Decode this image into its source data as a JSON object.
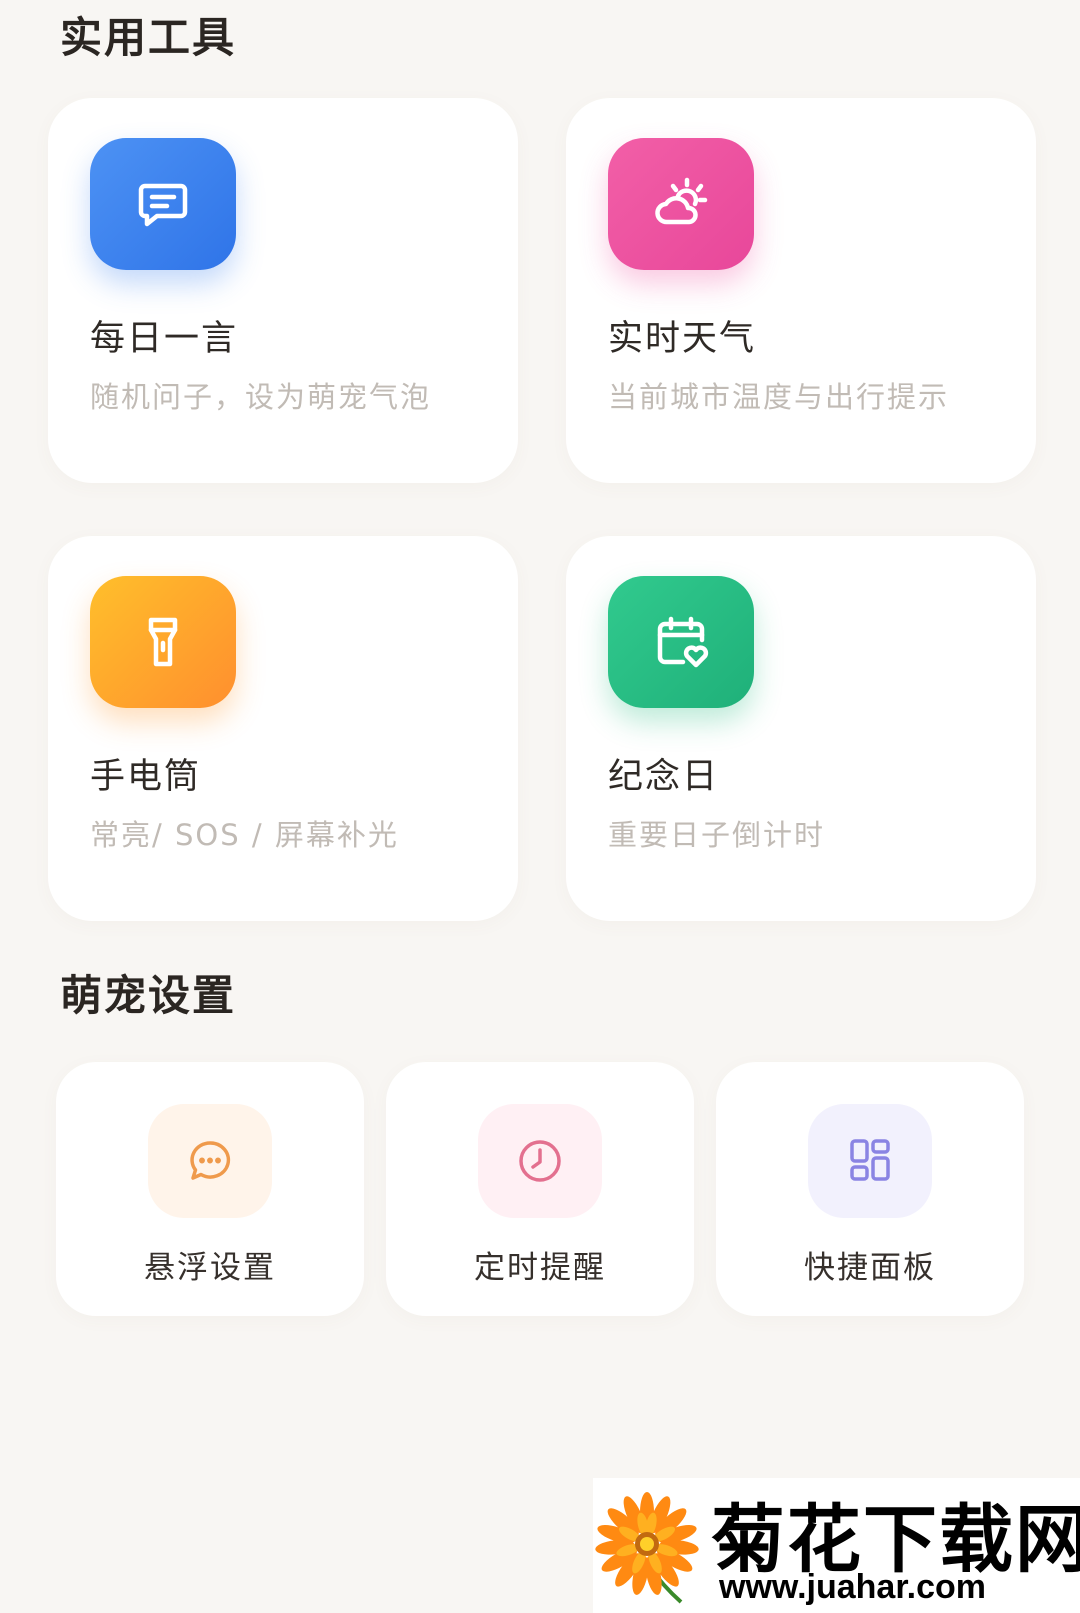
{
  "sections": {
    "tools_title": "实用工具",
    "pet_title": "萌宠设置"
  },
  "tools": [
    {
      "name": "每日一言",
      "desc": "随机问子，设为萌宠气泡",
      "icon": "chat-message-icon",
      "color": "#3a82ee"
    },
    {
      "name": "实时天气",
      "desc": "当前城市温度与出行提示",
      "icon": "weather-cloud-sun-icon",
      "color": "#ec519f"
    },
    {
      "name": "手电筒",
      "desc": "常亮/ SOS / 屏幕补光",
      "icon": "flashlight-icon",
      "color": "#ffa52d"
    },
    {
      "name": "纪念日",
      "desc": "重要日子倒计时",
      "icon": "calendar-heart-icon",
      "color": "#26bd83"
    }
  ],
  "settings": [
    {
      "label": "悬浮设置",
      "icon": "floating-chat-icon",
      "color": "#ef9a4c"
    },
    {
      "label": "定时提醒",
      "icon": "clock-icon",
      "color": "#e3708f"
    },
    {
      "label": "快捷面板",
      "icon": "grid-panel-icon",
      "color": "#8a84e3"
    }
  ],
  "watermark": {
    "title": "菊花下载网",
    "url": "www.juahar.com"
  }
}
